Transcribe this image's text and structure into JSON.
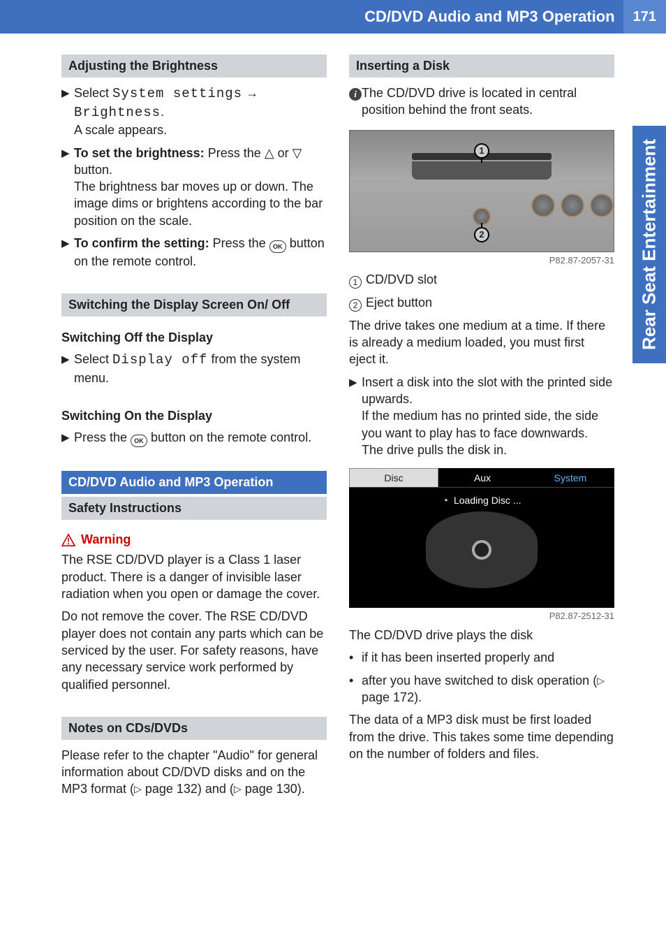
{
  "header": {
    "title": "CD/DVD Audio and MP3 Operation",
    "page": "171"
  },
  "thumb_tab": "Rear Seat Entertainment",
  "left": {
    "adj_bright": {
      "heading": "Adjusting the Brightness",
      "step1_pre": "Select ",
      "step1_mono1": "System settings",
      "step1_arrow": " → ",
      "step1_mono2": "Brightness",
      "step1_post": ".",
      "step1_result": "A scale appears.",
      "step2_bold": "To set the brightness:",
      "step2_rest": " Press the △ or ▽ button.",
      "step2_result": "The brightness bar moves up or down. The image dims or brightens according to the bar position on the scale.",
      "step3_bold": "To confirm the setting:",
      "step3_rest_a": " Press the ",
      "step3_ok": "OK",
      "step3_rest_b": " button on the remote control."
    },
    "switch_disp": {
      "heading": "Switching the Display Screen On/ Off",
      "off_head": "Switching Off the Display",
      "off_step_pre": "Select ",
      "off_step_mono": "Display off",
      "off_step_post": " from the system menu.",
      "on_head": "Switching On the Display",
      "on_step_a": "Press the ",
      "on_step_ok": "OK",
      "on_step_b": " button on the remote control."
    },
    "cd_dvd": {
      "heading": "CD/DVD Audio and MP3 Operation",
      "safety_head": "Safety Instructions",
      "warning_label": "Warning",
      "warning_p1": "The RSE CD/DVD player is a Class 1 laser product. There is a danger of invisible laser radiation when you open or damage the cover.",
      "warning_p2": "Do not remove the cover. The RSE CD/DVD player does not contain any parts which can be serviced by the user. For safety reasons, have any necessary service work performed by qualified personnel.",
      "notes_head": "Notes on CDs/DVDs",
      "notes_p_a": "Please refer to the chapter \"Audio\" for general information about CD/DVD disks and on the MP3 format (",
      "notes_ref1": " page 132) and (",
      "notes_ref2": " page 130)."
    }
  },
  "right": {
    "insert": {
      "heading": "Inserting a Disk",
      "info": "The CD/DVD drive is located in central position behind the front seats.",
      "fig1_id": "P82.87-2057-31",
      "fig1_num1": "1",
      "fig1_num2": "2",
      "legend1": "CD/DVD slot",
      "legend2": "Eject button",
      "p1": "The drive takes one medium at a time. If there is already a medium loaded, you must first eject it.",
      "step_a": "Insert a disk into the slot with the printed side upwards.",
      "step_b": "If the medium has no printed side, the side you want to play has to face downwards.",
      "step_c": "The drive pulls the disk in.",
      "fig2": {
        "tab1": "Disc",
        "tab2": "Aux",
        "tab3": "System",
        "loading": "Loading Disc ...",
        "id": "P82.87-2512-31"
      },
      "p2": "The CD/DVD drive plays the disk",
      "bul1": "if it has been inserted properly and",
      "bul2_a": "after you have switched to disk operation (",
      "bul2_ref": " page 172).",
      "p3": "The data of a MP3 disk must be first loaded from the drive. This takes some time depending on the number of folders and files."
    }
  }
}
